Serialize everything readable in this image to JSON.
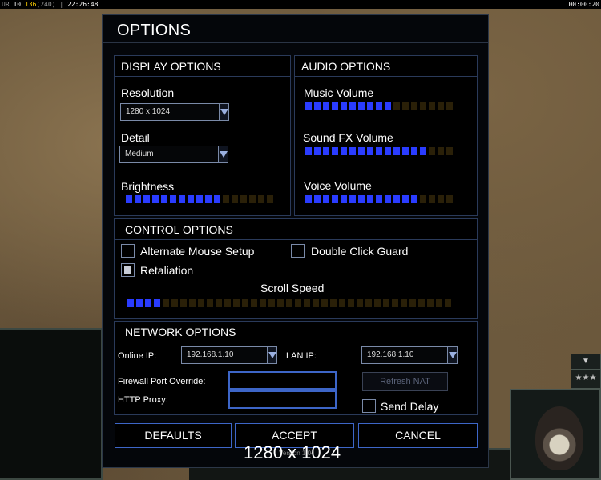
{
  "hud": {
    "left_prefix": "UR",
    "left_val1": "10",
    "left_val2": "136",
    "left_val3": "(240)",
    "clock": "22:26:48",
    "timer": "00:00:20"
  },
  "dialog": {
    "title": "OPTIONS",
    "display": {
      "header": "DISPLAY OPTIONS",
      "resolution_label": "Resolution",
      "resolution_value": "1280 x 1024",
      "detail_label": "Detail",
      "detail_value": "Medium",
      "brightness_label": "Brightness",
      "brightness_level": 11,
      "brightness_segments": 17
    },
    "audio": {
      "header": "AUDIO OPTIONS",
      "music_label": "Music Volume",
      "music_level": 10,
      "music_segments": 17,
      "sfx_label": "Sound FX Volume",
      "sfx_level": 14,
      "sfx_segments": 17,
      "voice_label": "Voice Volume",
      "voice_level": 13,
      "voice_segments": 17
    },
    "control": {
      "header": "CONTROL OPTIONS",
      "alt_mouse_label": "Alternate Mouse Setup",
      "alt_mouse_checked": false,
      "double_click_label": "Double Click Guard",
      "double_click_checked": false,
      "retaliation_label": "Retaliation",
      "retaliation_checked": true,
      "scroll_label": "Scroll Speed",
      "scroll_level": 4,
      "scroll_segments": 37
    },
    "network": {
      "header": "NETWORK OPTIONS",
      "online_ip_label": "Online IP:",
      "online_ip_value": "192.168.1.10",
      "lan_ip_label": "LAN IP:",
      "lan_ip_value": "192.168.1.10",
      "firewall_label": "Firewall Port Override:",
      "firewall_value": "",
      "proxy_label": "HTTP Proxy:",
      "proxy_value": "",
      "refresh_nat_label": "Refresh NAT",
      "send_delay_label": "Send Delay",
      "send_delay_checked": false
    },
    "buttons": {
      "defaults": "DEFAULTS",
      "accept": "ACCEPT",
      "cancel": "CANCEL"
    },
    "version_text": "Version 1.04"
  },
  "overlay_resolution": "1280 x 1024",
  "colors": {
    "slider_on": "#2a3cff",
    "slider_off": "#2a2008",
    "border_blue": "#3d66c8"
  }
}
